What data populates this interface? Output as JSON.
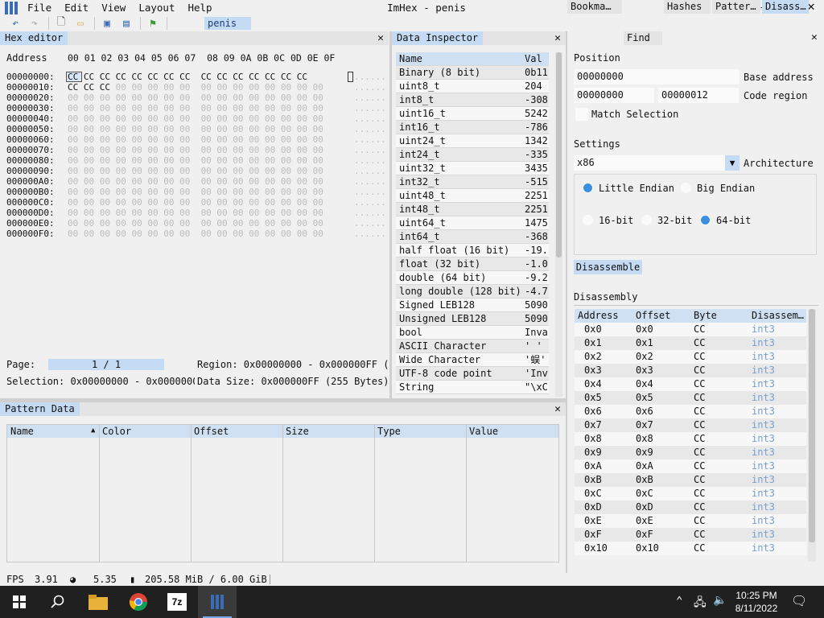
{
  "window": {
    "title": "ImHex - penis",
    "menu": [
      "File",
      "Edit",
      "View",
      "Layout",
      "Help"
    ],
    "file_tab": "penis"
  },
  "hex_editor": {
    "title": "Hex editor",
    "address_label": "Address",
    "columns": "00 01 02 03 04 05 06 07  08 09 0A 0B 0C 0D 0E 0F",
    "rows": [
      {
        "offset": "00000000:",
        "bytes": "CC CC CC CC CC CC CC CC  CC CC CC CC CC CC CC",
        "ascii": "......",
        "cc": true
      },
      {
        "offset": "00000010:",
        "bytes": "CC CC CC 00 00 00 00 00  00 00 00 00 00 00 00 00",
        "ascii": "......",
        "cc": false
      },
      {
        "offset": "00000020:",
        "bytes": "00 00 00 00 00 00 00 00  00 00 00 00 00 00 00 00",
        "ascii": "......",
        "cc": false
      },
      {
        "offset": "00000030:",
        "bytes": "00 00 00 00 00 00 00 00  00 00 00 00 00 00 00 00",
        "ascii": "......",
        "cc": false
      },
      {
        "offset": "00000040:",
        "bytes": "00 00 00 00 00 00 00 00  00 00 00 00 00 00 00 00",
        "ascii": "......",
        "cc": false
      },
      {
        "offset": "00000050:",
        "bytes": "00 00 00 00 00 00 00 00  00 00 00 00 00 00 00 00",
        "ascii": "......",
        "cc": false
      },
      {
        "offset": "00000060:",
        "bytes": "00 00 00 00 00 00 00 00  00 00 00 00 00 00 00 00",
        "ascii": "......",
        "cc": false
      },
      {
        "offset": "00000070:",
        "bytes": "00 00 00 00 00 00 00 00  00 00 00 00 00 00 00 00",
        "ascii": "......",
        "cc": false
      },
      {
        "offset": "00000080:",
        "bytes": "00 00 00 00 00 00 00 00  00 00 00 00 00 00 00 00",
        "ascii": "......",
        "cc": false
      },
      {
        "offset": "00000090:",
        "bytes": "00 00 00 00 00 00 00 00  00 00 00 00 00 00 00 00",
        "ascii": "......",
        "cc": false
      },
      {
        "offset": "000000A0:",
        "bytes": "00 00 00 00 00 00 00 00  00 00 00 00 00 00 00 00",
        "ascii": "......",
        "cc": false
      },
      {
        "offset": "000000B0:",
        "bytes": "00 00 00 00 00 00 00 00  00 00 00 00 00 00 00 00",
        "ascii": "......",
        "cc": false
      },
      {
        "offset": "000000C0:",
        "bytes": "00 00 00 00 00 00 00 00  00 00 00 00 00 00 00 00",
        "ascii": "......",
        "cc": false
      },
      {
        "offset": "000000D0:",
        "bytes": "00 00 00 00 00 00 00 00  00 00 00 00 00 00 00 00",
        "ascii": "......",
        "cc": false
      },
      {
        "offset": "000000E0:",
        "bytes": "00 00 00 00 00 00 00 00  00 00 00 00 00 00 00 00",
        "ascii": "......",
        "cc": false
      },
      {
        "offset": "000000F0:",
        "bytes": "00 00 00 00 00 00 00 00  00 00 00 00 00 00 00 00",
        "ascii": "......",
        "cc": false
      }
    ],
    "page_label": "Page:",
    "page_value": "1 / 1",
    "region_label": "Region: 0x00000000 - 0x000000FF (",
    "selection_label": "Selection: 0x00000000 - 0x0000000",
    "data_size_label": "Data Size: 0x000000FF (255 Bytes)"
  },
  "data_inspector": {
    "title": "Data Inspector",
    "col_name": "Name",
    "col_value": "Val",
    "rows": [
      {
        "name": "Binary (8 bit)",
        "value": "0b11"
      },
      {
        "name": "uint8_t",
        "value": "204"
      },
      {
        "name": "int8_t",
        "value": "-308"
      },
      {
        "name": "uint16_t",
        "value": "5242"
      },
      {
        "name": "int16_t",
        "value": "-786"
      },
      {
        "name": "uint24_t",
        "value": "1342"
      },
      {
        "name": "int24_t",
        "value": "-335"
      },
      {
        "name": "uint32_t",
        "value": "3435"
      },
      {
        "name": "int32_t",
        "value": "-515"
      },
      {
        "name": "uint48_t",
        "value": "2251"
      },
      {
        "name": "int48_t",
        "value": "2251"
      },
      {
        "name": "uint64_t",
        "value": "1475"
      },
      {
        "name": "int64_t",
        "value": "-368"
      },
      {
        "name": "half float (16 bit)",
        "value": "-19."
      },
      {
        "name": "float (32 bit)",
        "value": "-1.0"
      },
      {
        "name": "double (64 bit)",
        "value": "-9.2"
      },
      {
        "name": "long double (128 bit)",
        "value": "-4.7"
      },
      {
        "name": "Signed LEB128",
        "value": "5090"
      },
      {
        "name": "Unsigned LEB128",
        "value": "5090"
      },
      {
        "name": "bool",
        "value": "Inva"
      },
      {
        "name": "ASCII Character",
        "value": "' '"
      },
      {
        "name": "Wide Character",
        "value": "'蜈'"
      },
      {
        "name": "UTF-8 code point",
        "value": "'Inv"
      },
      {
        "name": "String",
        "value": "\"\\xC"
      }
    ]
  },
  "right_panel": {
    "tabs": [
      "Bookma…",
      "Find",
      "Hashes",
      "Patter…",
      "Disass…"
    ],
    "position_label": "Position",
    "base_address_value": "00000000",
    "base_address_label": "Base address",
    "code_region_start": "00000000",
    "code_region_end": "00000012",
    "code_region_label": "Code region",
    "match_selection_label": "Match Selection",
    "settings_label": "Settings",
    "architecture_value": "x86",
    "architecture_label": "Architecture",
    "endian_little": "Little Endian",
    "endian_big": "Big Endian",
    "bit16": "16-bit",
    "bit32": "32-bit",
    "bit64": "64-bit",
    "disassemble_button": "Disassemble",
    "disassembly_label": "Disassembly",
    "dis_cols": [
      "Address",
      "Offset",
      "Byte",
      "Disassem…"
    ],
    "dis_rows": [
      {
        "addr": "0x0",
        "off": "0x0",
        "byte": "CC",
        "ins": "int3"
      },
      {
        "addr": "0x1",
        "off": "0x1",
        "byte": "CC",
        "ins": "int3"
      },
      {
        "addr": "0x2",
        "off": "0x2",
        "byte": "CC",
        "ins": "int3"
      },
      {
        "addr": "0x3",
        "off": "0x3",
        "byte": "CC",
        "ins": "int3"
      },
      {
        "addr": "0x4",
        "off": "0x4",
        "byte": "CC",
        "ins": "int3"
      },
      {
        "addr": "0x5",
        "off": "0x5",
        "byte": "CC",
        "ins": "int3"
      },
      {
        "addr": "0x6",
        "off": "0x6",
        "byte": "CC",
        "ins": "int3"
      },
      {
        "addr": "0x7",
        "off": "0x7",
        "byte": "CC",
        "ins": "int3"
      },
      {
        "addr": "0x8",
        "off": "0x8",
        "byte": "CC",
        "ins": "int3"
      },
      {
        "addr": "0x9",
        "off": "0x9",
        "byte": "CC",
        "ins": "int3"
      },
      {
        "addr": "0xA",
        "off": "0xA",
        "byte": "CC",
        "ins": "int3"
      },
      {
        "addr": "0xB",
        "off": "0xB",
        "byte": "CC",
        "ins": "int3"
      },
      {
        "addr": "0xC",
        "off": "0xC",
        "byte": "CC",
        "ins": "int3"
      },
      {
        "addr": "0xD",
        "off": "0xD",
        "byte": "CC",
        "ins": "int3"
      },
      {
        "addr": "0xE",
        "off": "0xE",
        "byte": "CC",
        "ins": "int3"
      },
      {
        "addr": "0xF",
        "off": "0xF",
        "byte": "CC",
        "ins": "int3"
      },
      {
        "addr": "0x10",
        "off": "0x10",
        "byte": "CC",
        "ins": "int3"
      }
    ]
  },
  "pattern_data": {
    "title": "Pattern Data",
    "cols": [
      "Name",
      "Color",
      "Offset",
      "Size",
      "Type",
      "Value"
    ]
  },
  "status": {
    "fps_label": "FPS",
    "fps_value": "3.91",
    "cpu_value": "5.35",
    "memory_value": "205.58 MiB / 6.00 GiB"
  },
  "taskbar": {
    "time": "10:25 PM",
    "date": "8/11/2022"
  },
  "colors": {
    "accent": "#c4dbf3",
    "brand": "#3a6bb5",
    "radio_on": "#3a8fe0"
  }
}
